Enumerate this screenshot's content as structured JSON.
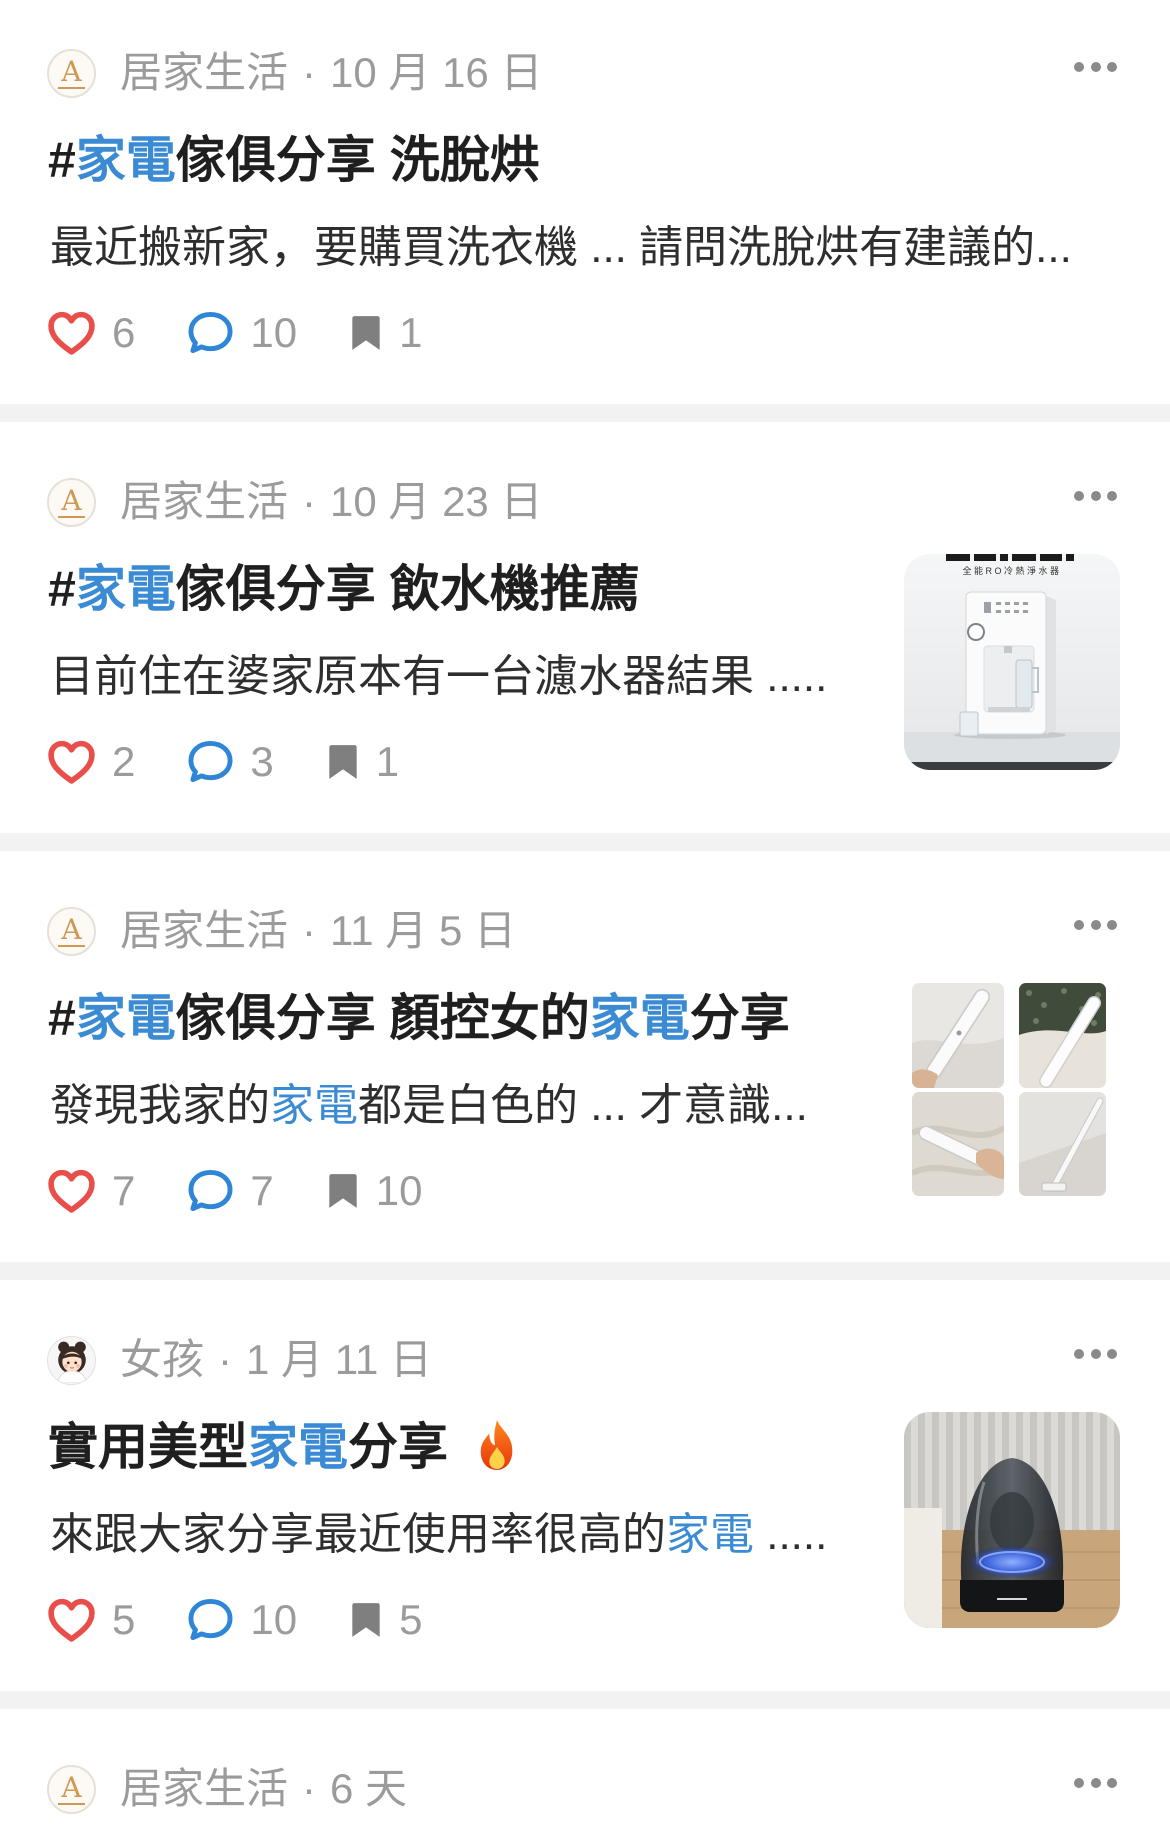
{
  "feed_icons": {
    "more": "more-dots-icon",
    "like": "heart-icon",
    "comment": "comment-bubble-icon",
    "save": "bookmark-icon"
  },
  "colors": {
    "highlight": "#3b8bd4",
    "like": "#e94f4a",
    "comment": "#2f86d6",
    "save": "#7f7f7f",
    "meta_text": "#9b9b9b",
    "title_text": "#1f1f1f",
    "body_text": "#2e2e2e",
    "divider": "#f2f2f2"
  },
  "posts": [
    {
      "avatar": {
        "icon": "community-logo-icon",
        "logo_text": "A"
      },
      "community": "居家生活",
      "date": "10 月 16 日",
      "title": [
        {
          "text": "#",
          "highlight": false
        },
        {
          "text": "家電",
          "highlight": true
        },
        {
          "text": "傢俱分享 洗脫烘",
          "highlight": false
        }
      ],
      "excerpt": [
        {
          "text": "最近搬新家，要購買洗衣機 ... 請問洗脫烘有建議的...",
          "highlight": false
        }
      ],
      "likes": "6",
      "comments": "10",
      "saves": "1"
    },
    {
      "avatar": {
        "icon": "community-logo-icon",
        "logo_text": "A"
      },
      "community": "居家生活",
      "date": "10 月 23 日",
      "title": [
        {
          "text": "#",
          "highlight": false
        },
        {
          "text": "家電",
          "highlight": true
        },
        {
          "text": "傢俱分享 飲水機推薦",
          "highlight": false
        }
      ],
      "excerpt": [
        {
          "text": "目前住在婆家原本有一台濾水器結果 .....",
          "highlight": false
        }
      ],
      "likes": "2",
      "comments": "3",
      "saves": "1",
      "thumbnail": {
        "icon": "water-dispenser-photo",
        "photo_text": "全能RO冷熱淨水器"
      }
    },
    {
      "avatar": {
        "icon": "community-logo-icon",
        "logo_text": "A"
      },
      "community": "居家生活",
      "date": "11 月 5 日",
      "title": [
        {
          "text": "#",
          "highlight": false
        },
        {
          "text": "家電",
          "highlight": true
        },
        {
          "text": "傢俱分享 顏控女的",
          "highlight": false
        },
        {
          "text": "家電",
          "highlight": true
        },
        {
          "text": "分享",
          "highlight": false
        }
      ],
      "excerpt": [
        {
          "text": "發現我家的",
          "highlight": false
        },
        {
          "text": "家電",
          "highlight": true
        },
        {
          "text": "都是白色的 ... 才意識...",
          "highlight": false
        }
      ],
      "likes": "7",
      "comments": "7",
      "saves": "10",
      "thumbnail": {
        "icon": "vacuum-collage-photo"
      }
    },
    {
      "avatar": {
        "icon": "girl-avatar-icon"
      },
      "community": "女孩",
      "date": "1 月 11 日",
      "title": [
        {
          "text": "實用美型",
          "highlight": false
        },
        {
          "text": "家電",
          "highlight": true
        },
        {
          "text": "分享",
          "highlight": false
        }
      ],
      "title_icon": "fire-icon",
      "excerpt": [
        {
          "text": "來跟大家分享最近使用率很高的",
          "highlight": false
        },
        {
          "text": "家電",
          "highlight": true
        },
        {
          "text": " .....",
          "highlight": false
        }
      ],
      "likes": "5",
      "comments": "10",
      "saves": "5",
      "thumbnail": {
        "icon": "dome-speaker-photo"
      }
    },
    {
      "avatar": {
        "icon": "community-logo-icon",
        "logo_text": "A"
      },
      "community": "居家生活",
      "date": "6 天"
    }
  ]
}
